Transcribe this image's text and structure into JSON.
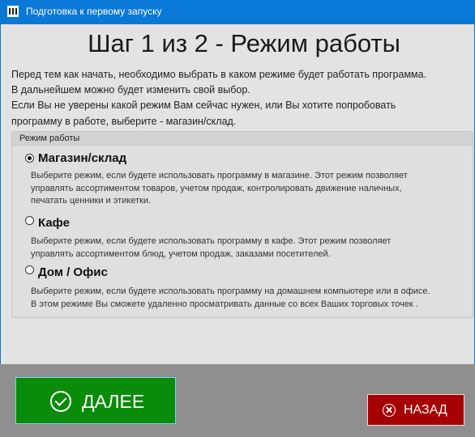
{
  "window": {
    "title": "Подготовка к первому запуску"
  },
  "heading": "Шаг 1 из 2  -  Режим работы",
  "intro": [
    "Перед тем как начать, необходимо выбрать в каком режиме будет работать программа.",
    "В дальнейшем можно будет изменить свой выбор.",
    "Если Вы не уверены какой режим Вам сейчас нужен, или Вы хотите попробовать",
    "программу в работе, выберите - магазин/склад."
  ],
  "mode_group": {
    "title": "Режим работы",
    "selected": "Магазин/склад",
    "options": [
      {
        "label": "Магазин/склад",
        "checked": true,
        "description": [
          " Выберите режим, если будете использовать программу в магазине. Этот режим позволяет",
          "управлять ассортиментом товаров, учетом продаж, контролировать движение наличных,",
          "печатать ценники и этикетки."
        ]
      },
      {
        "label": "Кафе",
        "checked": false,
        "description": [
          "Выберите режим, если будете использовать программу в кафе. Этот режим позволяет",
          "управлять ассортиментом блюд, учетом продаж, заказами посетителей."
        ]
      },
      {
        "label": "Дом / Офис",
        "checked": false,
        "description": [
          "Выберите режим, если будете использовать программу на домашнем компьютере или в офисе.",
          "В этом режиме Вы сможете удаленно просматривать  данные со всех Ваших торговых точек ."
        ]
      }
    ]
  },
  "buttons": {
    "next": "ДАЛЕЕ",
    "back": "НАЗАД"
  },
  "colors": {
    "titlebar": "#0a78d7",
    "next_button": "#098c09",
    "back_button": "#a70003",
    "bottom_bar": "#8f8f8f"
  }
}
